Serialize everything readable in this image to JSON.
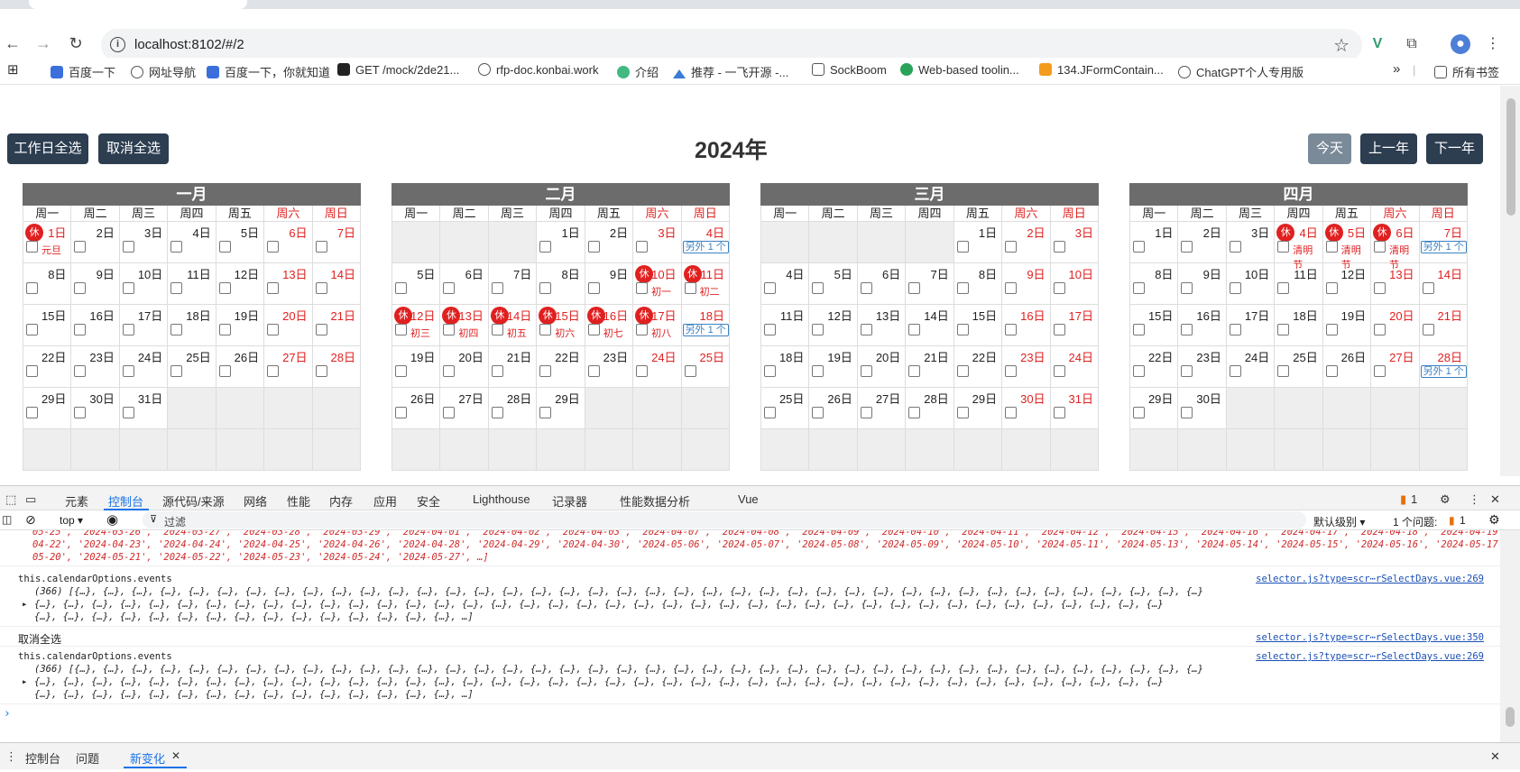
{
  "browser": {
    "url": "localhost:8102/#/2",
    "bookmarks": [
      "百度一下",
      "网址导航",
      "百度一下，你就知道",
      "GET /mock/2de21...",
      "rfp-doc.konbai.work",
      "介绍",
      "推荐 - 一飞开源 -...",
      "SockBoom",
      "Web-based toolin...",
      "134.JFormContain...",
      "ChatGPT个人专用版"
    ],
    "all_bookmarks": "所有书签",
    "more": "»"
  },
  "calendar": {
    "title": "2024年",
    "btn_select_workdays": "工作日全选",
    "btn_cancel_all": "取消全选",
    "btn_today": "今天",
    "btn_prev_year": "上一年",
    "btn_next_year": "下一年",
    "weekdays": [
      "周一",
      "周二",
      "周三",
      "周四",
      "周五",
      "周六",
      "周日"
    ],
    "rest_label": "休",
    "more_label": "另外 1 个",
    "months": [
      {
        "name": "一月",
        "offset": 0,
        "days": 31,
        "rest": [
          1
        ],
        "lunar": {
          "1": "元旦"
        },
        "more": []
      },
      {
        "name": "二月",
        "offset": 3,
        "days": 29,
        "rest": [
          10,
          11,
          12,
          13,
          14,
          15,
          16,
          17
        ],
        "lunar": {
          "10": "初一",
          "11": "初二",
          "12": "初三",
          "13": "初四",
          "14": "初五",
          "15": "初六",
          "16": "初七",
          "17": "初八"
        },
        "more": [
          4,
          18
        ]
      },
      {
        "name": "三月",
        "offset": 4,
        "days": 31,
        "rest": [],
        "lunar": {},
        "more": []
      },
      {
        "name": "四月",
        "offset": 0,
        "days": 30,
        "rest": [
          4,
          5,
          6
        ],
        "lunar": {
          "4": "清明节",
          "5": "清明节",
          "6": "清明节"
        },
        "more": [
          7,
          28
        ]
      }
    ]
  },
  "devtools": {
    "tabs": [
      "元素",
      "控制台",
      "源代码/来源",
      "网络",
      "性能",
      "内存",
      "应用",
      "安全",
      "Lighthouse",
      "记录器",
      "性能数据分析",
      "Vue"
    ],
    "active_tab": "控制台",
    "issues_count": "1",
    "context": "top",
    "filter_placeholder": "过滤",
    "level": "默认级别",
    "issues_text": "1 个问题:",
    "issues_badge": "1",
    "logs": {
      "dates_line1": "05-25', '2024-03-26', '2024-03-27', '2024-03-28', '2024-03-29', '2024-04-01', '2024-04-02', '2024-04-03', '2024-04-07', '2024-04-08', '2024-04-09', '2024-04-10', '2024-04-11', '2024-04-12', '2024-04-15', '2024-04-16', '2024-04-17', '2024-04-18', '2024-04-19', '2024-",
      "dates_line2": "04-22', '2024-04-23', '2024-04-24', '2024-04-25', '2024-04-26', '2024-04-28', '2024-04-29', '2024-04-30', '2024-05-06', '2024-05-07', '2024-05-08', '2024-05-09', '2024-05-10', '2024-05-11', '2024-05-13', '2024-05-14', '2024-05-15', '2024-05-16', '2024-05-17', '2024-",
      "dates_line3": "05-20', '2024-05-21', '2024-05-22', '2024-05-23', '2024-05-24', '2024-05-27', …]",
      "events_label": "this.calendarOptions.events",
      "events_src": "selector.js?type=scr⋯rSelectDays.vue:269",
      "array_line": "(366) [{…}, {…}, {…}, {…}, {…}, {…}, {…}, {…}, {…}, {…}, {…}, {…}, {…}, {…}, {…}, {…}, {…}, {…}, {…}, {…}, {…}, {…}, {…}, {…}, {…}, {…}, {…}, {…}, {…}, {…}, {…}, {…}, {…}, {…}, {…}, {…}, {…}, {…}, {…}, {…}",
      "array_line2": "{…}, {…}, {…}, {…}, {…}, {…}, {…}, {…}, {…}, {…}, {…}, {…}, {…}, {…}, {…}, {…}, {…}, {…}, {…}, {…}, {…}, {…}, {…}, {…}, {…}, {…}, {…}, {…}, {…}, {…}, {…}, {…}, {…}, {…}, {…}, {…}, {…}, {…}, {…}, {…}",
      "array_line3": "{…}, {…}, {…}, {…}, {…}, {…}, {…}, {…}, {…}, {…}, {…}, {…}, {…}, {…}, {…}, …]",
      "cancel_log": "取消全选",
      "cancel_src": "selector.js?type=scr⋯rSelectDays.vue:350",
      "events_src2": "selector.js?type=scr⋯rSelectDays.vue:269"
    },
    "drawer_tabs": [
      "控制台",
      "问题",
      "新变化"
    ]
  }
}
